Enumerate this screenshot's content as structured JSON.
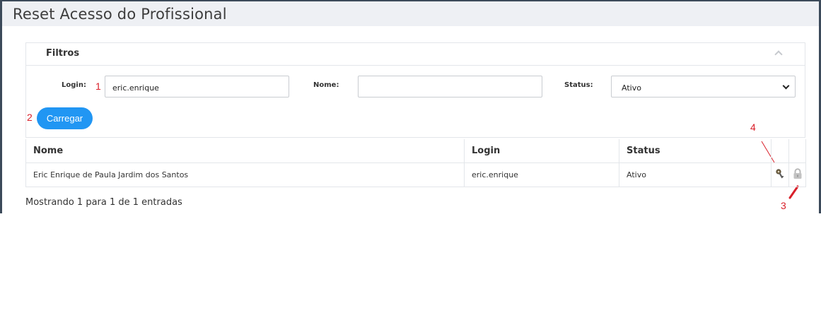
{
  "page": {
    "title": "Reset Acesso do Profissional"
  },
  "filters": {
    "title": "Filtros",
    "login_label": "Login:",
    "login_value": "eric.enrique",
    "nome_label": "Nome:",
    "nome_value": "",
    "status_label": "Status:",
    "status_selected": "Ativo",
    "load_button": "Carregar"
  },
  "table": {
    "headers": [
      "Nome",
      "Login",
      "Status"
    ],
    "rows": [
      {
        "nome": "Eric Enrique de Paula Jardim dos Santos",
        "login": "eric.enrique",
        "status": "Ativo"
      }
    ],
    "info": "Mostrando 1 para 1 de 1 entradas"
  },
  "annotations": [
    "1",
    "2",
    "3",
    "4"
  ],
  "icons": {
    "row_action_1": "key-icon",
    "row_action_2": "lock-icon",
    "collapse": "chevron-up-icon",
    "select": "chevron-down-icon"
  },
  "colors": {
    "primary": "#2196f3",
    "annotation": "#d9202a",
    "header_bg": "#eef0f4"
  }
}
